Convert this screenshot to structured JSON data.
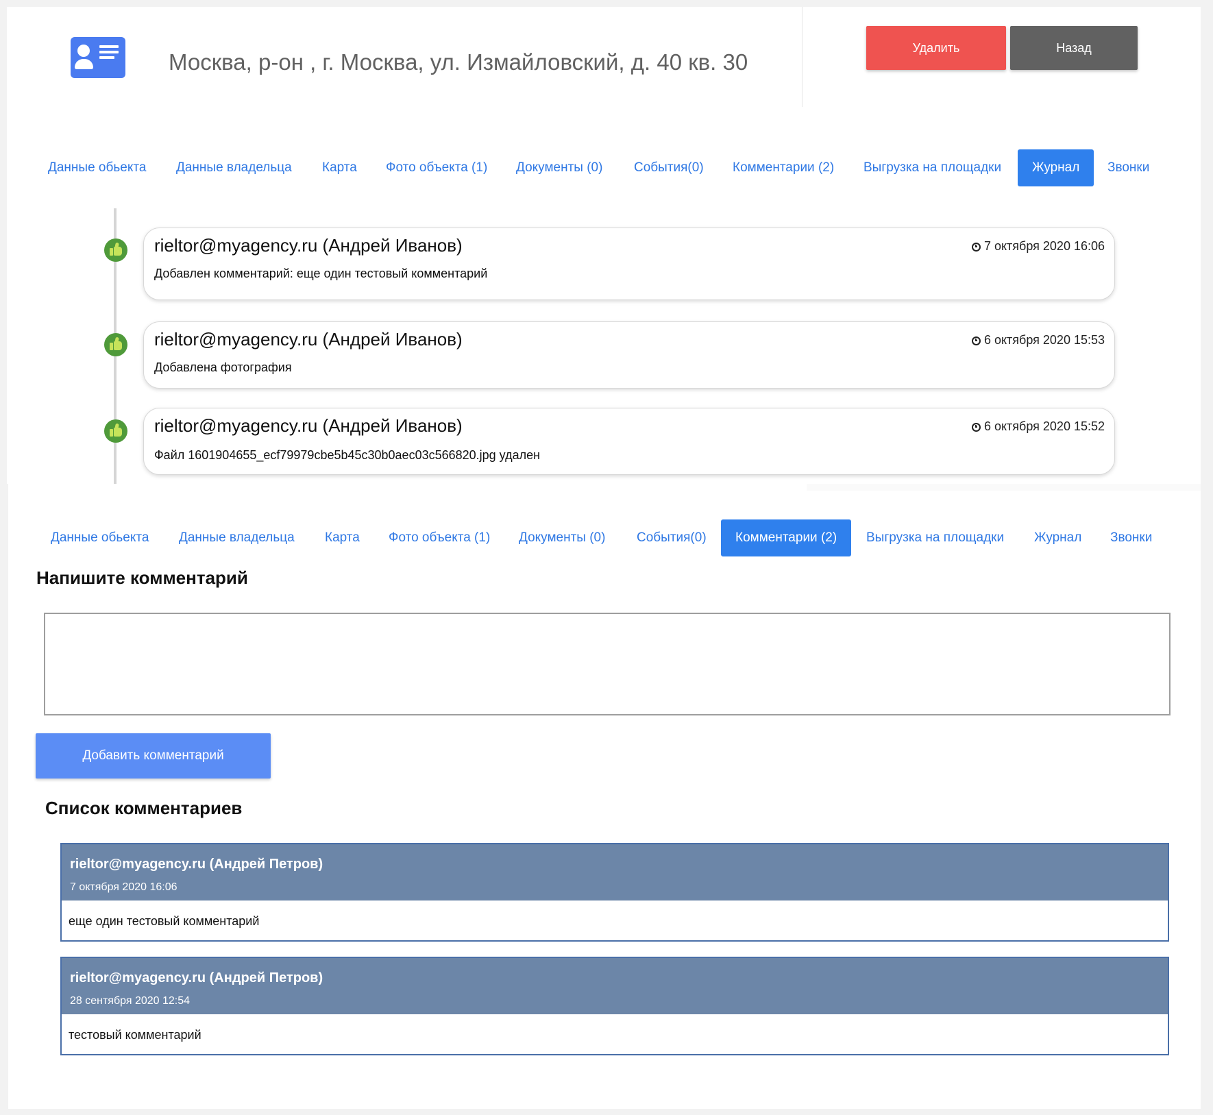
{
  "header": {
    "address": "Москва, р-он , г. Москва, ул. Измайловский, д. 40 кв. 30",
    "delete_label": "Удалить",
    "back_label": "Назад",
    "icon": "contact-card-icon"
  },
  "tabs_journal": [
    {
      "label": "Данные обьекта"
    },
    {
      "label": "Данные владельца"
    },
    {
      "label": "Карта"
    },
    {
      "label": "Фото объекта (1)"
    },
    {
      "label": "Документы (0)"
    },
    {
      "label": "События(0)"
    },
    {
      "label": "Комментарии (2)"
    },
    {
      "label": "Выгрузка на площадки"
    },
    {
      "label": "Журнал",
      "active": true
    },
    {
      "label": "Звонки"
    }
  ],
  "journal": {
    "entries": [
      {
        "author": "rieltor@myagency.ru (Андрей Иванов)",
        "time": "7 октября 2020 16:06",
        "message": "Добавлен комментарий: еще один тестовый комментарий",
        "icon": "thumbs-up-icon"
      },
      {
        "author": "rieltor@myagency.ru (Андрей Иванов)",
        "time": "6 октября 2020 15:53",
        "message": "Добавлена фотография",
        "icon": "thumbs-up-icon"
      },
      {
        "author": "rieltor@myagency.ru (Андрей Иванов)",
        "time": "6 октября 2020 15:52",
        "message": "Файл 1601904655_ecf79979cbe5b45c30b0aec03c566820.jpg удален",
        "icon": "thumbs-up-icon"
      }
    ]
  },
  "tabs_comments": [
    {
      "label": "Данные обьекта"
    },
    {
      "label": "Данные владельца"
    },
    {
      "label": "Карта"
    },
    {
      "label": "Фото объекта (1)"
    },
    {
      "label": "Документы (0)"
    },
    {
      "label": "События(0)"
    },
    {
      "label": "Комментарии (2)",
      "active": true
    },
    {
      "label": "Выгрузка на площадки"
    },
    {
      "label": "Журнал"
    },
    {
      "label": "Звонки"
    }
  ],
  "comments": {
    "write_title": "Напишите комментарий",
    "input_value": "",
    "add_label": "Добавить комментарий",
    "list_title": "Список комментариев",
    "items": [
      {
        "author": "rieltor@myagency.ru (Андрей Петров)",
        "date": "7 октября 2020 16:06",
        "text": "еще один тестовый комментарий"
      },
      {
        "author": "rieltor@myagency.ru (Андрей Петров)",
        "date": "28 сентября 2020 12:54",
        "text": "тестовый комментарий"
      }
    ]
  },
  "colors": {
    "accent_blue": "#2f80ed",
    "tab_text": "#2f78e4",
    "delete_red": "#ef5350",
    "back_gray": "#616161",
    "add_button": "#5b8df5",
    "comment_header": "#6c86a8",
    "timeline_icon_green": "#4f9a3a"
  }
}
